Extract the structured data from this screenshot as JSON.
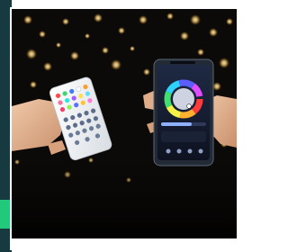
{
  "image": {
    "subject": "product-photo",
    "colors": {
      "background": "#0c0a08",
      "sidebar": "#163a3f",
      "accent": "#23c97a",
      "bokeh": "#f2c46a"
    }
  }
}
